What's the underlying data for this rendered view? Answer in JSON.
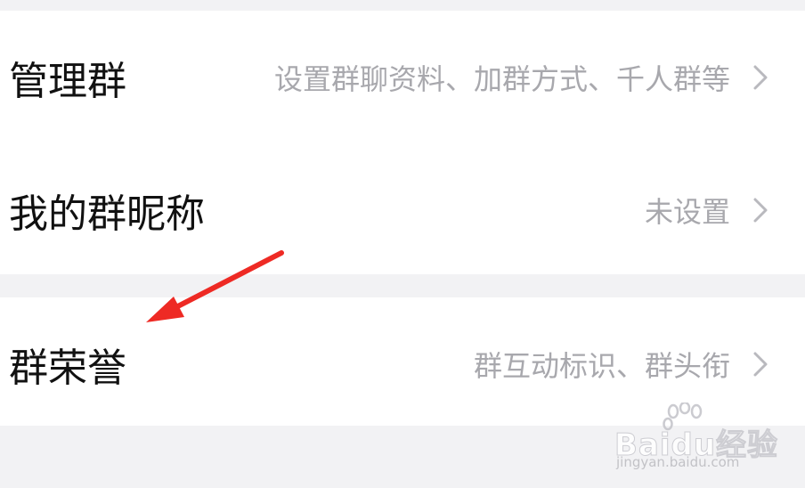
{
  "settings": {
    "rows": [
      {
        "label": "管理群",
        "value": "设置群聊资料、加群方式、千人群等"
      },
      {
        "label": "我的群昵称",
        "value": "未设置"
      },
      {
        "label": "群荣誉",
        "value": "群互动标识、群头衔"
      }
    ]
  },
  "watermark": {
    "logo_text": "Baidu经验",
    "url_text": "jingyan.baidu.com"
  },
  "annotation": {
    "arrow_color": "#ee2a24"
  },
  "colors": {
    "background": "#f2f2f4",
    "card": "#ffffff",
    "label_text": "#111111",
    "value_text": "#a8a8ad"
  }
}
